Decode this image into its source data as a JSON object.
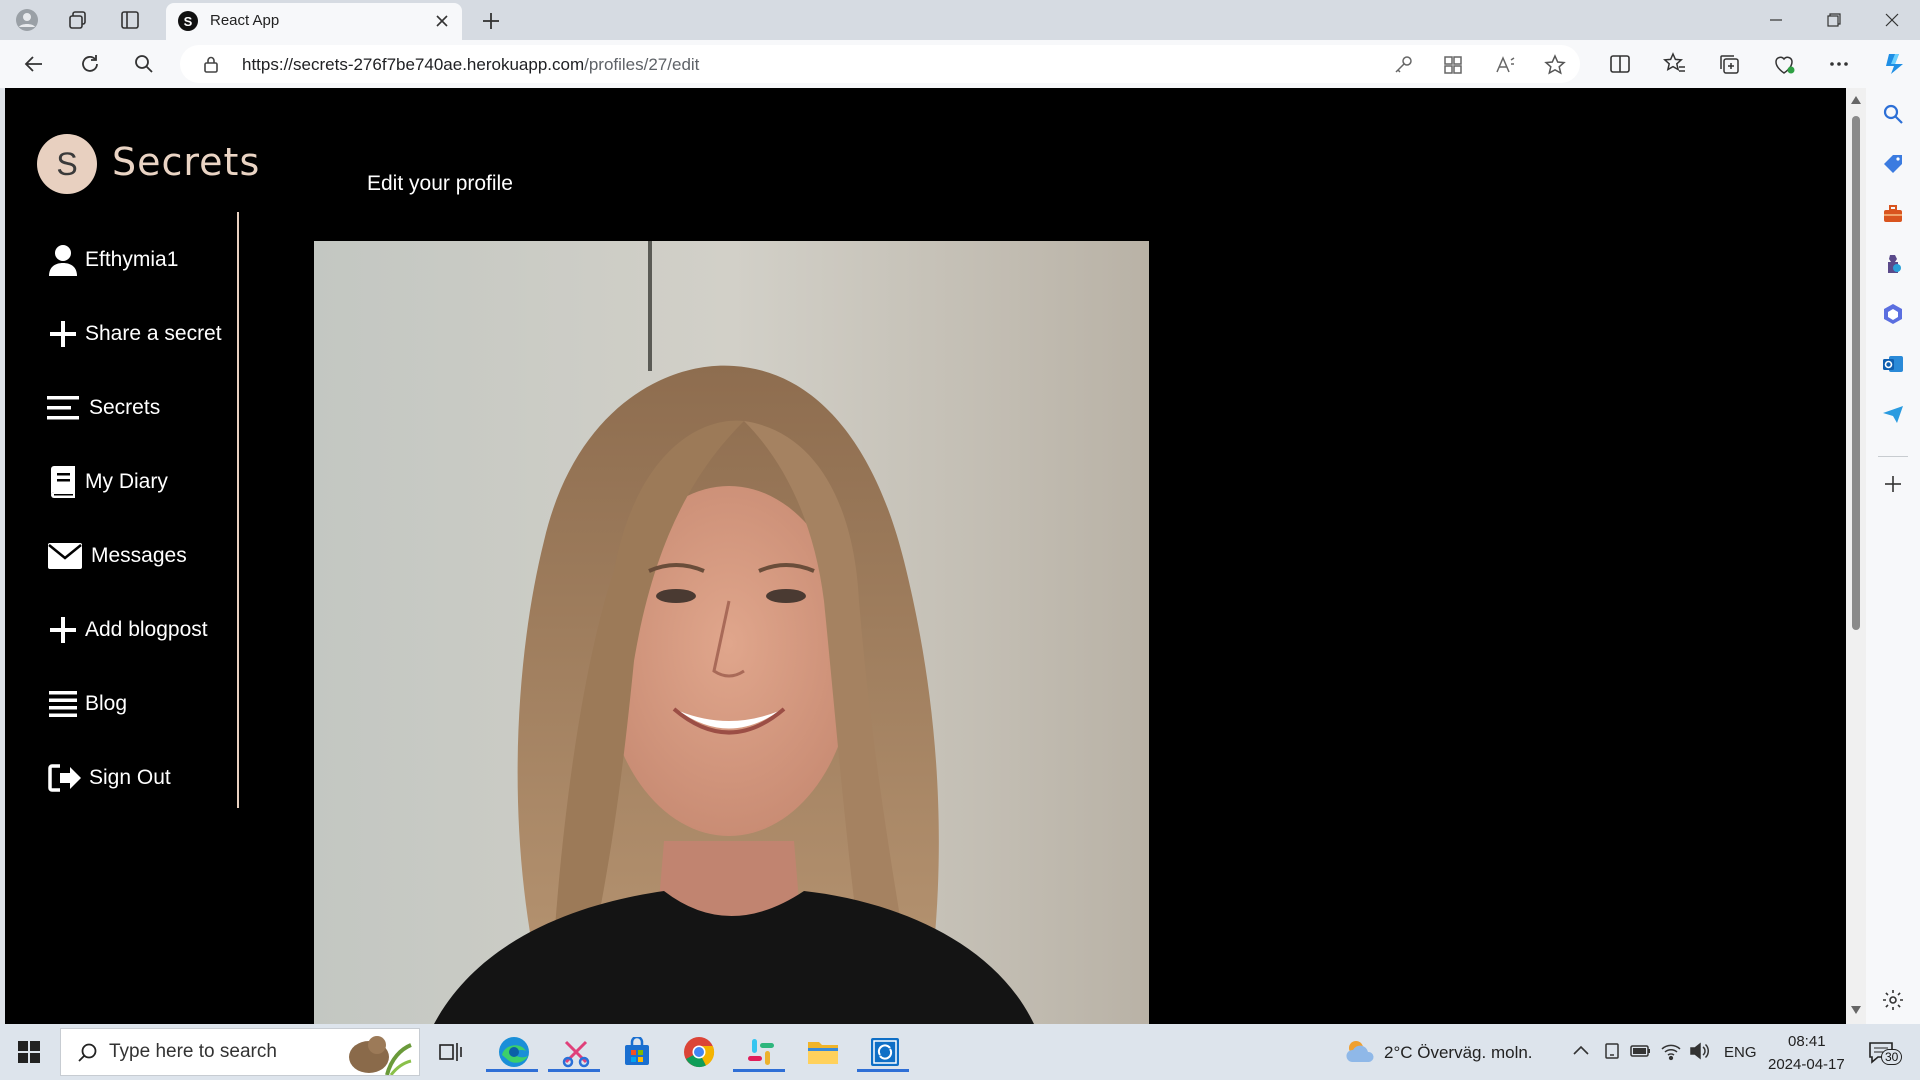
{
  "browser": {
    "tab_title": "React App",
    "favicon_letter": "S",
    "url_host": "https://secrets-276f7be740ae.herokuapp.com",
    "url_path": "/profiles/27/edit"
  },
  "app": {
    "logo_letter": "S",
    "brand": "Secrets",
    "heading": "Edit your profile",
    "nav": [
      {
        "label": "Efthymia1",
        "icon": "user-icon"
      },
      {
        "label": "Share a secret",
        "icon": "plus-icon"
      },
      {
        "label": "Secrets",
        "icon": "list-icon"
      },
      {
        "label": "My Diary",
        "icon": "book-icon"
      },
      {
        "label": "Messages",
        "icon": "envelope-icon"
      },
      {
        "label": "Add blogpost",
        "icon": "plus-icon"
      },
      {
        "label": "Blog",
        "icon": "lines-icon"
      },
      {
        "label": "Sign Out",
        "icon": "sign-out-icon"
      }
    ]
  },
  "taskbar": {
    "search_placeholder": "Type here to search",
    "weather": "2°C  Överväg. moln.",
    "language": "ENG",
    "time": "08:41",
    "date": "2024-04-17",
    "notifications": "30"
  },
  "colors": {
    "page_bg": "#000000",
    "accent": "#e8d0c0",
    "taskbar_accent": "#2f6fd6"
  }
}
